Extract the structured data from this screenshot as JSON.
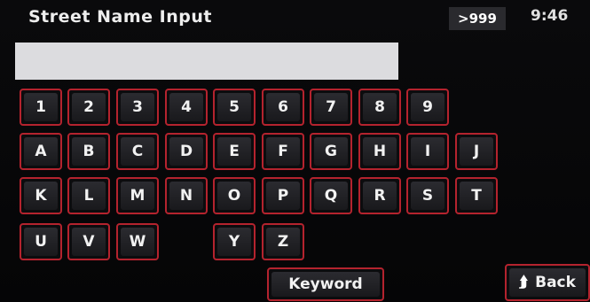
{
  "header": {
    "title": "Street Name Input",
    "count_badge": ">999",
    "clock": "9:46"
  },
  "input": {
    "value": "",
    "placeholder": ""
  },
  "keyboard": {
    "digits": [
      "1",
      "2",
      "3",
      "4",
      "5",
      "6",
      "7",
      "8",
      "9"
    ],
    "row_aj": [
      "A",
      "B",
      "C",
      "D",
      "E",
      "F",
      "G",
      "H",
      "I",
      "J"
    ],
    "row_kt": [
      "K",
      "L",
      "M",
      "N",
      "O",
      "P",
      "Q",
      "R",
      "S",
      "T"
    ],
    "row_uz": [
      "U",
      "V",
      "W",
      "Y",
      "Z"
    ]
  },
  "footer": {
    "keyword_label": "Keyword",
    "back_label": "Back",
    "back_icon": "return-arrow-icon"
  },
  "colors": {
    "key_border": "#b4232e",
    "background": "#0b0b0d",
    "input_bg": "#dcdcdf"
  }
}
